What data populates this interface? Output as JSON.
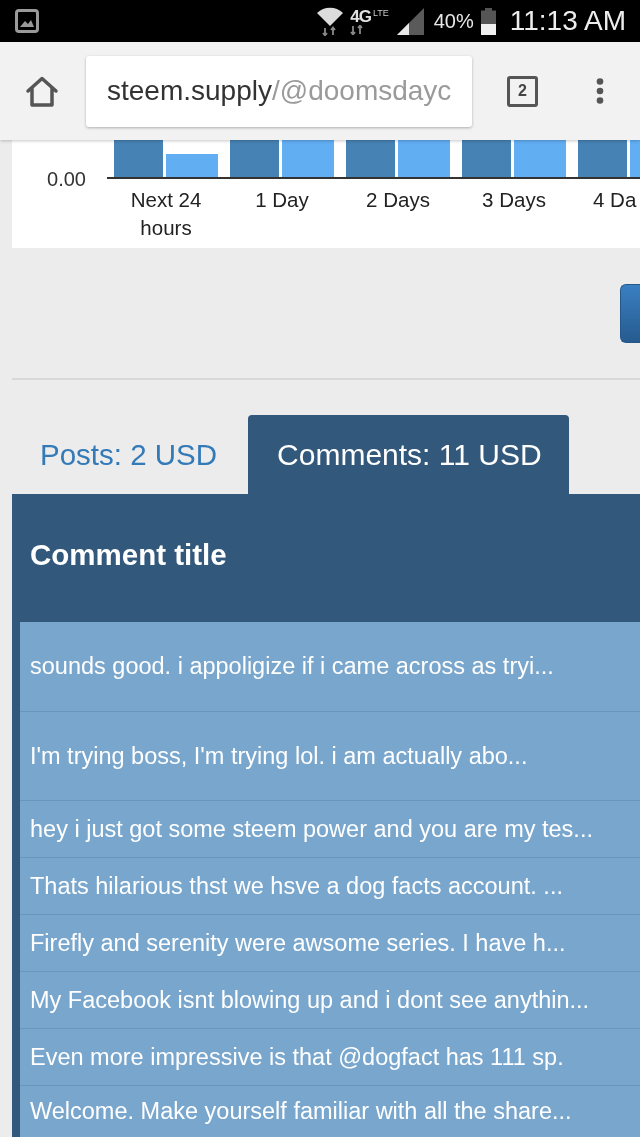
{
  "status_bar": {
    "network": "4G",
    "network_sub": "LTE",
    "battery": "40%",
    "time": "11:13 AM"
  },
  "browser": {
    "url_host": "steem.supply",
    "url_path": "/@doomsdayc",
    "tab_count": "2"
  },
  "chart": {
    "y_tick": "0.00",
    "categories": [
      "Next 24 hours",
      "1 Day",
      "2 Days",
      "3 Days",
      "4 Da"
    ]
  },
  "tabs": [
    {
      "label": "Posts: 2 USD",
      "selected": false
    },
    {
      "label": "Comments: 11 USD",
      "selected": true
    }
  ],
  "panel": {
    "title": "Comment title",
    "rows": [
      "sounds good. i appoligize if i came across as tryi...",
      "I'm trying boss, I'm trying lol. i am actually abo...",
      "hey i just got some steem power and you are my tes...",
      "Thats hilarious thst we hsve a dog facts account. ...",
      "Firefly and serenity were awsome series. I have h...",
      "My Facebook isnt blowing up and i dont see anythin...",
      "Even more impressive is that @dogfact has 111 sp.",
      "Welcome. Make yourself familiar with all the share..."
    ]
  }
}
